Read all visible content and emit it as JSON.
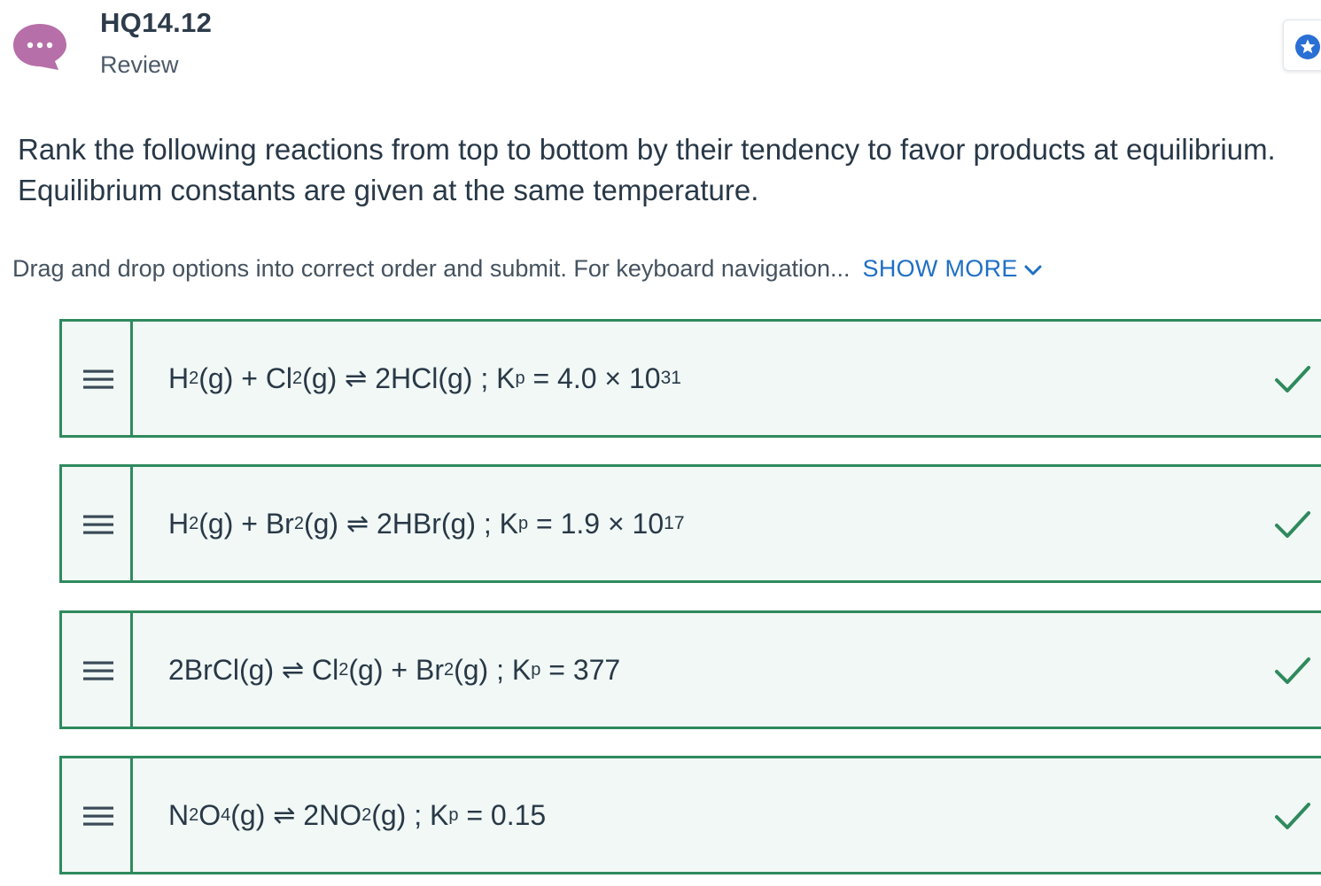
{
  "header": {
    "title": "HQ14.12",
    "subtitle": "Review",
    "chat_icon": "chat-bubble-icon",
    "star_icon": "star-icon",
    "colors": {
      "chat": "#b66fa8",
      "star": "#2a6fd4"
    }
  },
  "question": {
    "line1": "Rank the following reactions from top to bottom by their tendency to favor products at equilibrium.",
    "line2": "Equilibrium constants are given at the same temperature."
  },
  "instructions": {
    "text": "Drag and drop options into correct order and submit. For keyboard navigation...",
    "show_more": "SHOW MORE",
    "show_more_icon": "chevron-down-icon"
  },
  "ranking_items": [
    {
      "handle_icon": "drag-handle-icon",
      "status_icon": "checkmark-icon",
      "parts": [
        {
          "t": "H"
        },
        {
          "sub": "2"
        },
        {
          "t": "(g) + Cl"
        },
        {
          "sub": "2"
        },
        {
          "t": "(g) "
        },
        {
          "eq": "⇌"
        },
        {
          "t": " 2HCl(g) ; K"
        },
        {
          "sub": "p"
        },
        {
          "t": " = 4.0 × 10"
        },
        {
          "sup": "31"
        }
      ]
    },
    {
      "handle_icon": "drag-handle-icon",
      "status_icon": "checkmark-icon",
      "parts": [
        {
          "t": "H"
        },
        {
          "sub": "2"
        },
        {
          "t": "(g) + Br"
        },
        {
          "sub": "2"
        },
        {
          "t": "(g) "
        },
        {
          "eq": "⇌"
        },
        {
          "t": " 2HBr(g) ; K"
        },
        {
          "sub": "p"
        },
        {
          "t": " = 1.9 × 10"
        },
        {
          "sup": "17"
        }
      ]
    },
    {
      "handle_icon": "drag-handle-icon",
      "status_icon": "checkmark-icon",
      "parts": [
        {
          "t": "2BrCl(g) "
        },
        {
          "eq": "⇌"
        },
        {
          "t": " Cl"
        },
        {
          "sub": "2"
        },
        {
          "t": "(g) + Br"
        },
        {
          "sub": "2"
        },
        {
          "t": "(g) ; K"
        },
        {
          "sub": "p"
        },
        {
          "t": " = 377"
        }
      ]
    },
    {
      "handle_icon": "drag-handle-icon",
      "status_icon": "checkmark-icon",
      "parts": [
        {
          "t": "N"
        },
        {
          "sub": "2"
        },
        {
          "t": "O"
        },
        {
          "sub": "4"
        },
        {
          "t": "(g) "
        },
        {
          "eq": "⇌"
        },
        {
          "t": " 2NO"
        },
        {
          "sub": "2"
        },
        {
          "t": "(g) ; K"
        },
        {
          "sub": "p"
        },
        {
          "t": " = 0.15"
        }
      ]
    }
  ],
  "colors": {
    "item_border": "#2f8a5d",
    "item_background": "#f1f8f5",
    "check": "#2f8a5d",
    "link": "#1f6fc5"
  }
}
